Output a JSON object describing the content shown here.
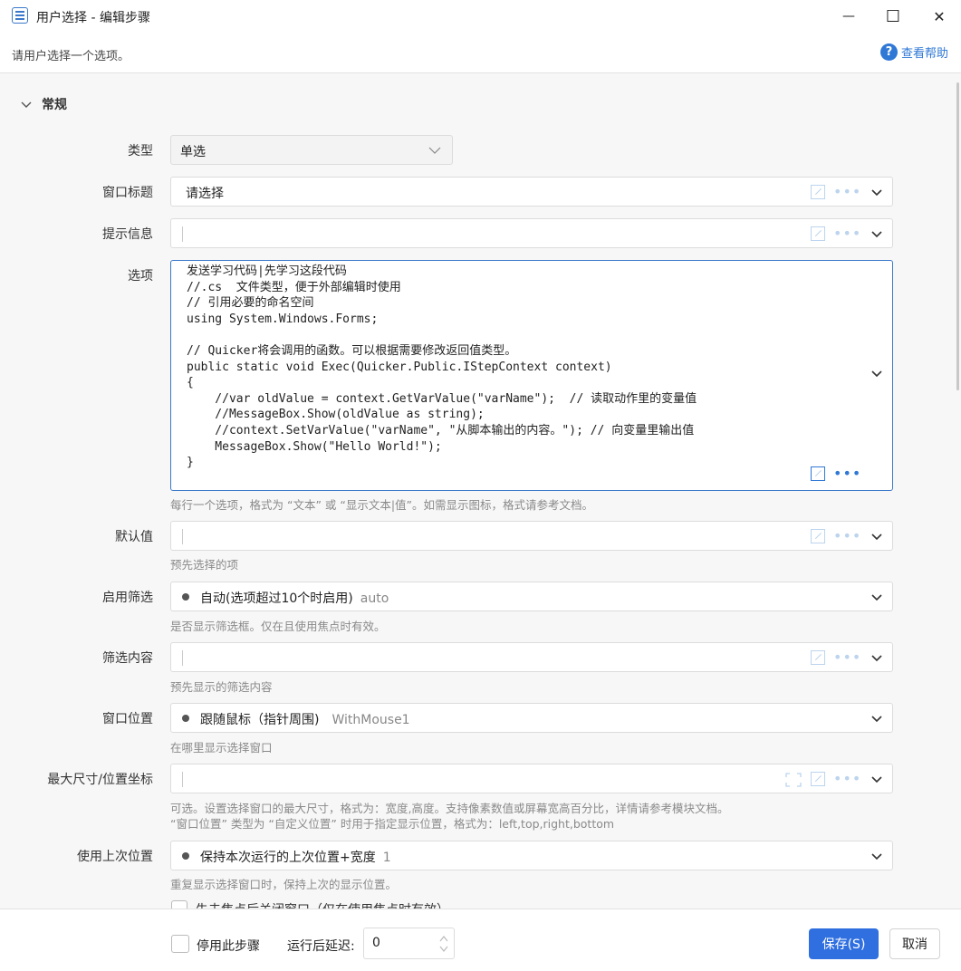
{
  "window": {
    "title": "用户选择  -  编辑步骤",
    "minimize": "—",
    "maximize": "☐",
    "close": "✕"
  },
  "header": {
    "subtitle": "请用户选择一个选项。",
    "help_label": "查看帮助",
    "help_icon": "?"
  },
  "section": {
    "title": "常规"
  },
  "fields": {
    "type": {
      "label": "类型",
      "value": "单选"
    },
    "window_title": {
      "label": "窗口标题",
      "value": "请选择"
    },
    "prompt": {
      "label": "提示信息",
      "value": ""
    },
    "options": {
      "label": "选项",
      "lines": [
        "发送学习代码|先学习这段代码",
        "//.cs  文件类型，便于外部编辑时使用",
        "// 引用必要的命名空间",
        "using System.Windows.Forms;",
        "",
        "// Quicker将会调用的函数。可以根据需要修改返回值类型。",
        "public static void Exec(Quicker.Public.IStepContext context)",
        "{",
        "    //var oldValue = context.GetVarValue(\"varName\");  // 读取动作里的变量值",
        "    //MessageBox.Show(oldValue as string);",
        "    //context.SetVarValue(\"varName\", \"从脚本输出的内容。\"); // 向变量里输出值",
        "    MessageBox.Show(\"Hello World!\");",
        "}"
      ],
      "hint": "每行一个选项，格式为 “文本” 或 “显示文本|值”。如需显示图标，格式请参考文档。"
    },
    "default_value": {
      "label": "默认值",
      "value": "",
      "hint": "预先选择的项"
    },
    "enable_filter": {
      "label": "启用筛选",
      "value": "自动(选项超过10个时启用)",
      "code": "auto",
      "hint": "是否显示筛选框。仅在且使用焦点时有效。"
    },
    "filter_content": {
      "label": "筛选内容",
      "value": "",
      "hint": "预先显示的筛选内容"
    },
    "window_position": {
      "label": "窗口位置",
      "value": "跟随鼠标（指针周围)",
      "code": "WithMouse1",
      "hint": "在哪里显示选择窗口"
    },
    "max_size": {
      "label": "最大尺寸/位置坐标",
      "value": "",
      "hint_line1": "可选。设置选择窗口的最大尺寸，格式为：宽度,高度。支持像素数值或屏幕宽高百分比，详情请参考模块文档。",
      "hint_line2": "“窗口位置” 类型为 “自定义位置” 时用于指定显示位置，格式为：left,top,right,bottom"
    },
    "use_last_position": {
      "label": "使用上次位置",
      "value": "保持本次运行的上次位置+宽度",
      "code": "1",
      "hint": "重复显示选择窗口时，保持上次的显示位置。"
    },
    "close_on_blur": {
      "label": "失去焦点后关闭窗口（仅在使用焦点时有效）",
      "checked": false
    }
  },
  "footer": {
    "disable_step_label": "停用此步骤",
    "disable_step_checked": false,
    "delay_label": "运行后延迟:",
    "delay_value": "0",
    "save_label": "保存(S)",
    "cancel_label": "取消"
  },
  "colors": {
    "accent": "#2f78d6",
    "primary_button": "#2f6fe0",
    "border": "#dcdcdc",
    "focus_border": "#3a78c9",
    "hint_text": "#8a8a8a"
  }
}
